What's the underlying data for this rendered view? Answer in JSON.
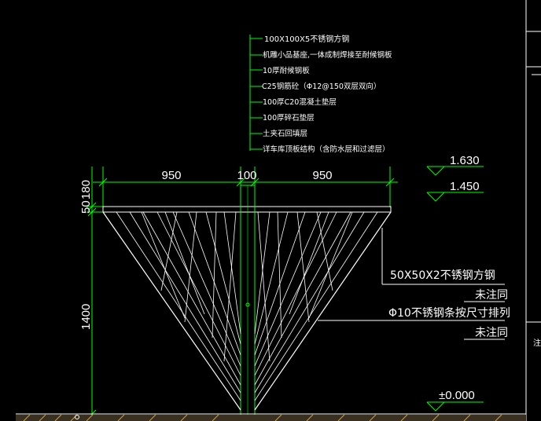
{
  "layers": [
    "100X100X5不锈钢方钢",
    "机雕小品基座,一体成制焊接至耐候钢板",
    "10厚耐候钢板",
    "C25钢筋砼（Φ12@150双层双向）",
    "100厚C20混凝土垫层",
    "100厚碎石垫层",
    "土夹石回填层",
    "详车库顶板结构（含防水层和过滤层）"
  ],
  "dimensions": {
    "top": [
      "950",
      "100",
      "950"
    ],
    "left": [
      "50",
      "180",
      "1400"
    ]
  },
  "levels": [
    "1.630",
    "1.450",
    "±0.000"
  ],
  "notes": [
    "50X50X2不锈钢方钢",
    "未注同",
    "Φ10不锈钢条按尺寸排列",
    "未注同"
  ],
  "colors": {
    "background": "#000000",
    "structure": "#ffffff",
    "dimension": "#00ff00",
    "level_mark": "#00ff00",
    "text": "#ffffff",
    "footing": "#c8a050"
  }
}
